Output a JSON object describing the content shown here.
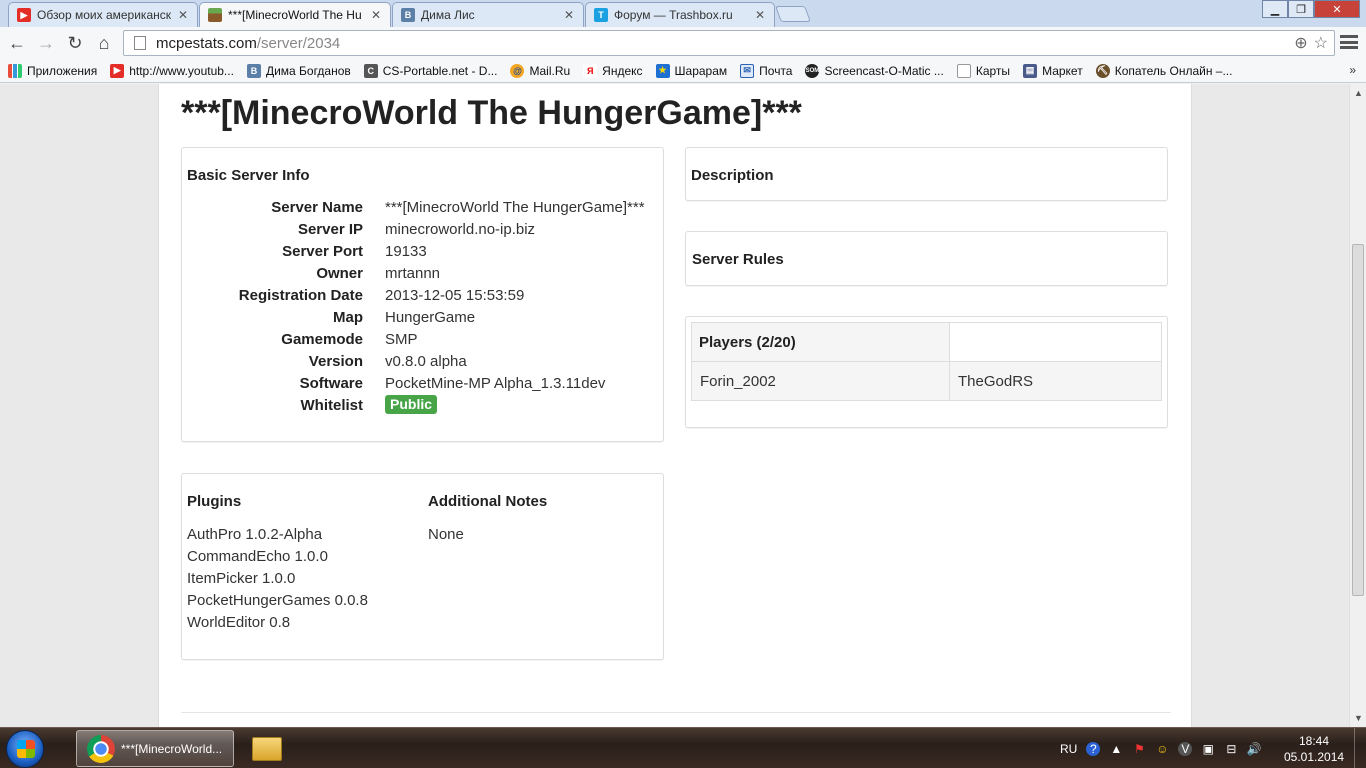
{
  "browser": {
    "tabs": [
      {
        "title": "Обзор моих американских",
        "favicon": "youtube-icon"
      },
      {
        "title": "***[MinecroWorld The Hu",
        "favicon": "minecraft-icon"
      },
      {
        "title": "Дима Лис",
        "favicon": "vk-icon"
      },
      {
        "title": "Форум — Trashbox.ru",
        "favicon": "trashbox-icon"
      }
    ],
    "url_host": "mcpestats.com",
    "url_path": "/server/2034",
    "bookmarks": [
      {
        "label": "Приложения",
        "icon": "apps-icon"
      },
      {
        "label": "http://www.youtub...",
        "icon": "youtube-icon"
      },
      {
        "label": "Дима Богданов",
        "icon": "vk-icon"
      },
      {
        "label": "CS-Portable.net - D...",
        "icon": "cs-icon"
      },
      {
        "label": "Mail.Ru",
        "icon": "mailru-icon"
      },
      {
        "label": "Яндекс",
        "icon": "yandex-icon"
      },
      {
        "label": "Шарарам",
        "icon": "shararam-icon"
      },
      {
        "label": "Почта",
        "icon": "mail-icon"
      },
      {
        "label": "Screencast-O-Matic ...",
        "icon": "screencast-icon"
      },
      {
        "label": "Карты",
        "icon": "page-icon"
      },
      {
        "label": "Маркет",
        "icon": "market-icon"
      },
      {
        "label": "Копатель Онлайн –...",
        "icon": "kopatel-icon"
      }
    ],
    "bookmarks_more": "»"
  },
  "page": {
    "title": "***[MinecroWorld The HungerGame]***",
    "basic_info": {
      "heading": "Basic Server Info",
      "rows": [
        {
          "key": "Server Name",
          "value": "***[MinecroWorld The HungerGame]***"
        },
        {
          "key": "Server IP",
          "value": "minecroworld.no-ip.biz"
        },
        {
          "key": "Server Port",
          "value": "19133"
        },
        {
          "key": "Owner",
          "value": "mrtannn"
        },
        {
          "key": "Registration Date",
          "value": "2013-12-05 15:53:59"
        },
        {
          "key": "Map",
          "value": "HungerGame"
        },
        {
          "key": "Gamemode",
          "value": "SMP"
        },
        {
          "key": "Version",
          "value": "v0.8.0 alpha"
        },
        {
          "key": "Software",
          "value": "PocketMine-MP Alpha_1.3.11dev"
        }
      ],
      "whitelist_key": "Whitelist",
      "whitelist_value": "Public"
    },
    "plugins": {
      "heading": "Plugins",
      "items": [
        "AuthPro 1.0.2-Alpha",
        "CommandEcho 1.0.0",
        "ItemPicker 1.0.0",
        "PocketHungerGames 0.0.8",
        "WorldEditor 0.8"
      ]
    },
    "notes": {
      "heading": "Additional Notes",
      "value": "None"
    },
    "description": {
      "heading": "Description"
    },
    "rules": {
      "heading": "Server Rules"
    },
    "players": {
      "heading": "Players (2/20)",
      "names": [
        "Forin_2002",
        "TheGodRS"
      ]
    },
    "colors": {
      "public_badge": "#47a447"
    }
  },
  "taskbar": {
    "chrome_task": "***[MinecroWorld...",
    "language": "RU",
    "time": "18:44",
    "date": "05.01.2014"
  }
}
